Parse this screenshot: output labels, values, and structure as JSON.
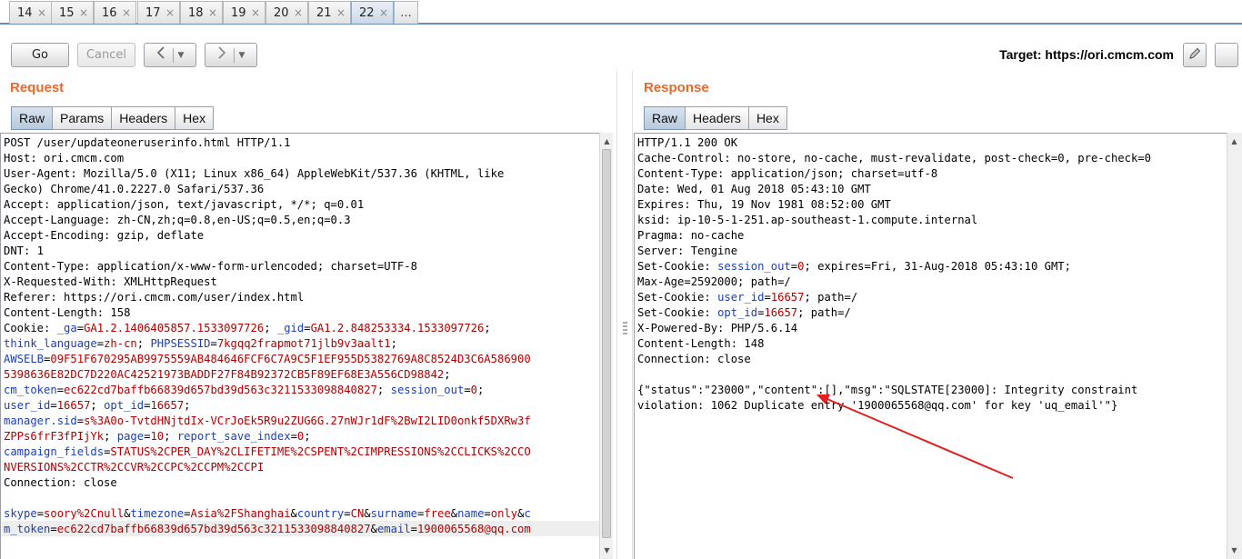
{
  "tabs": [
    {
      "label": "14"
    },
    {
      "label": "15"
    },
    {
      "label": "16"
    },
    {
      "label": "17"
    },
    {
      "label": "18"
    },
    {
      "label": "19"
    },
    {
      "label": "20"
    },
    {
      "label": "21"
    },
    {
      "label": "22",
      "active": true
    }
  ],
  "tabs_more_label": "...",
  "tab_close_glyph": "×",
  "toolbar": {
    "go_label": "Go",
    "cancel_label": "Cancel",
    "back_icon": "chevron-left-icon",
    "forward_icon": "chevron-right-icon",
    "target_label": "Target:",
    "target_url": "https://ori.cmcm.com",
    "edit_icon": "pencil-icon",
    "help_icon": "help-icon"
  },
  "request": {
    "title": "Request",
    "tabs": [
      "Raw",
      "Params",
      "Headers",
      "Hex"
    ],
    "active_tab": "Raw",
    "lines": [
      [
        {
          "t": "POST /user/updateoneruserinfo.html HTTP/1.1"
        }
      ],
      [
        {
          "t": "Host: ori.cmcm.com"
        }
      ],
      [
        {
          "t": "User-Agent: Mozilla/5.0 (X11; Linux x86_64) AppleWebKit/537.36 (KHTML, like"
        }
      ],
      [
        {
          "t": "Gecko) Chrome/41.0.2227.0 Safari/537.36"
        }
      ],
      [
        {
          "t": "Accept: application/json, text/javascript, */*; q=0.01"
        }
      ],
      [
        {
          "t": "Accept-Language: zh-CN,zh;q=0.8,en-US;q=0.5,en;q=0.3"
        }
      ],
      [
        {
          "t": "Accept-Encoding: gzip, deflate"
        }
      ],
      [
        {
          "t": "DNT: 1"
        }
      ],
      [
        {
          "t": "Content-Type: application/x-www-form-urlencoded; charset=UTF-8"
        }
      ],
      [
        {
          "t": "X-Requested-With: XMLHttpRequest"
        }
      ],
      [
        {
          "t": "Referer: https://ori.cmcm.com/user/index.html"
        }
      ],
      [
        {
          "t": "Content-Length: 158"
        }
      ],
      [
        {
          "t": "Cookie: "
        },
        {
          "t": "_ga",
          "c": "k"
        },
        {
          "t": "="
        },
        {
          "t": "GA1.2.1406405857.1533097726",
          "c": "v"
        },
        {
          "t": "; "
        },
        {
          "t": "_gid",
          "c": "k"
        },
        {
          "t": "="
        },
        {
          "t": "GA1.2.848253334.1533097726",
          "c": "v"
        },
        {
          "t": ";"
        }
      ],
      [
        {
          "t": "think_language",
          "c": "k"
        },
        {
          "t": "="
        },
        {
          "t": "zh-cn",
          "c": "v"
        },
        {
          "t": "; "
        },
        {
          "t": "PHPSESSID",
          "c": "k"
        },
        {
          "t": "="
        },
        {
          "t": "7kgqq2frapmot71jlb9v3aalt1",
          "c": "v"
        },
        {
          "t": ";"
        }
      ],
      [
        {
          "t": "AWSELB",
          "c": "k"
        },
        {
          "t": "="
        },
        {
          "t": "09F51F670295AB9975559AB484646FCF6C7A9C5F1EF955D5382769A8C8524D3C6A586900",
          "c": "v"
        }
      ],
      [
        {
          "t": "5398636E82DC7D220AC42521973BADDF27F84B92372CB5F89EF68E3A556CD98842",
          "c": "v"
        },
        {
          "t": ";"
        }
      ],
      [
        {
          "t": "cm_token",
          "c": "k"
        },
        {
          "t": "="
        },
        {
          "t": "ec622cd7baffb66839d657bd39d563c3211533098840827",
          "c": "v"
        },
        {
          "t": "; "
        },
        {
          "t": "session_out",
          "c": "k"
        },
        {
          "t": "="
        },
        {
          "t": "0",
          "c": "v"
        },
        {
          "t": ";"
        }
      ],
      [
        {
          "t": "user_id",
          "c": "k"
        },
        {
          "t": "="
        },
        {
          "t": "16657",
          "c": "v"
        },
        {
          "t": "; "
        },
        {
          "t": "opt_id",
          "c": "k"
        },
        {
          "t": "="
        },
        {
          "t": "16657",
          "c": "v"
        },
        {
          "t": ";"
        }
      ],
      [
        {
          "t": "manager.sid",
          "c": "k"
        },
        {
          "t": "="
        },
        {
          "t": "s%3A0o-TvtdHNjtdIx-VCrJoEk5R9u2ZUG6G.27nWJr1dF%2BwI2LID0onkf5DXRw3f",
          "c": "v"
        }
      ],
      [
        {
          "t": "ZPPs6frF3fPIjYk",
          "c": "v"
        },
        {
          "t": "; "
        },
        {
          "t": "page",
          "c": "k"
        },
        {
          "t": "="
        },
        {
          "t": "10",
          "c": "v"
        },
        {
          "t": "; "
        },
        {
          "t": "report_save_index",
          "c": "k"
        },
        {
          "t": "="
        },
        {
          "t": "0",
          "c": "v"
        },
        {
          "t": ";"
        }
      ],
      [
        {
          "t": "campaign_fields",
          "c": "k"
        },
        {
          "t": "="
        },
        {
          "t": "STATUS%2CPER_DAY%2CLIFETIME%2CSPENT%2CIMPRESSIONS%2CCLICKS%2CCO",
          "c": "v"
        }
      ],
      [
        {
          "t": "NVERSIONS%2CCTR%2CCVR%2CCPC%2CCPM%2CCPI",
          "c": "v"
        }
      ],
      [
        {
          "t": "Connection: close"
        }
      ],
      [
        {
          "t": ""
        }
      ],
      [
        {
          "t": "skype",
          "c": "k"
        },
        {
          "t": "="
        },
        {
          "t": "soory%2Cnull",
          "c": "v"
        },
        {
          "t": "&"
        },
        {
          "t": "timezone",
          "c": "k"
        },
        {
          "t": "="
        },
        {
          "t": "Asia%2FShanghai",
          "c": "v"
        },
        {
          "t": "&"
        },
        {
          "t": "country",
          "c": "k"
        },
        {
          "t": "="
        },
        {
          "t": "CN",
          "c": "v"
        },
        {
          "t": "&"
        },
        {
          "t": "surname",
          "c": "k"
        },
        {
          "t": "="
        },
        {
          "t": "free",
          "c": "v"
        },
        {
          "t": "&"
        },
        {
          "t": "name",
          "c": "k"
        },
        {
          "t": "="
        },
        {
          "t": "only",
          "c": "v"
        },
        {
          "t": "&"
        },
        {
          "t": "c",
          "c": "k"
        }
      ],
      [
        {
          "t": "m_token",
          "c": "k"
        },
        {
          "t": "="
        },
        {
          "t": "ec622cd7baffb66839d657bd39d563c3211533098840827",
          "c": "v"
        },
        {
          "t": "&"
        },
        {
          "t": "email",
          "c": "k"
        },
        {
          "t": "="
        },
        {
          "t": "1900065568@qq.com",
          "c": "v"
        }
      ]
    ]
  },
  "response": {
    "title": "Response",
    "tabs": [
      "Raw",
      "Headers",
      "Hex"
    ],
    "active_tab": "Raw",
    "lines": [
      [
        {
          "t": "HTTP/1.1 200 OK"
        }
      ],
      [
        {
          "t": "Cache-Control: no-store, no-cache, must-revalidate, post-check=0, pre-check=0"
        }
      ],
      [
        {
          "t": "Content-Type: application/json; charset=utf-8"
        }
      ],
      [
        {
          "t": "Date: Wed, 01 Aug 2018 05:43:10 GMT"
        }
      ],
      [
        {
          "t": "Expires: Thu, 19 Nov 1981 08:52:00 GMT"
        }
      ],
      [
        {
          "t": "ksid: ip-10-5-1-251.ap-southeast-1.compute.internal"
        }
      ],
      [
        {
          "t": "Pragma: no-cache"
        }
      ],
      [
        {
          "t": "Server: Tengine"
        }
      ],
      [
        {
          "t": "Set-Cookie: "
        },
        {
          "t": "session_out",
          "c": "k"
        },
        {
          "t": "="
        },
        {
          "t": "0",
          "c": "v"
        },
        {
          "t": "; expires=Fri, 31-Aug-2018 05:43:10 GMT;"
        }
      ],
      [
        {
          "t": "Max-Age=2592000; path=/"
        }
      ],
      [
        {
          "t": "Set-Cookie: "
        },
        {
          "t": "user_id",
          "c": "k"
        },
        {
          "t": "="
        },
        {
          "t": "16657",
          "c": "v"
        },
        {
          "t": "; path=/"
        }
      ],
      [
        {
          "t": "Set-Cookie: "
        },
        {
          "t": "opt_id",
          "c": "k"
        },
        {
          "t": "="
        },
        {
          "t": "16657",
          "c": "v"
        },
        {
          "t": "; path=/"
        }
      ],
      [
        {
          "t": "X-Powered-By: PHP/5.6.14"
        }
      ],
      [
        {
          "t": "Content-Length: 148"
        }
      ],
      [
        {
          "t": "Connection: close"
        }
      ],
      [
        {
          "t": ""
        }
      ],
      [
        {
          "t": "{\"status\":\"23000\",\"content\":[],\"msg\":\"SQLSTATE[23000]: Integrity constraint"
        }
      ],
      [
        {
          "t": "violation: 1062 Duplicate entry '1900065568@qq.com' for key 'uq_email'\"}"
        }
      ]
    ]
  },
  "annotation": {
    "color": "#e02020"
  }
}
